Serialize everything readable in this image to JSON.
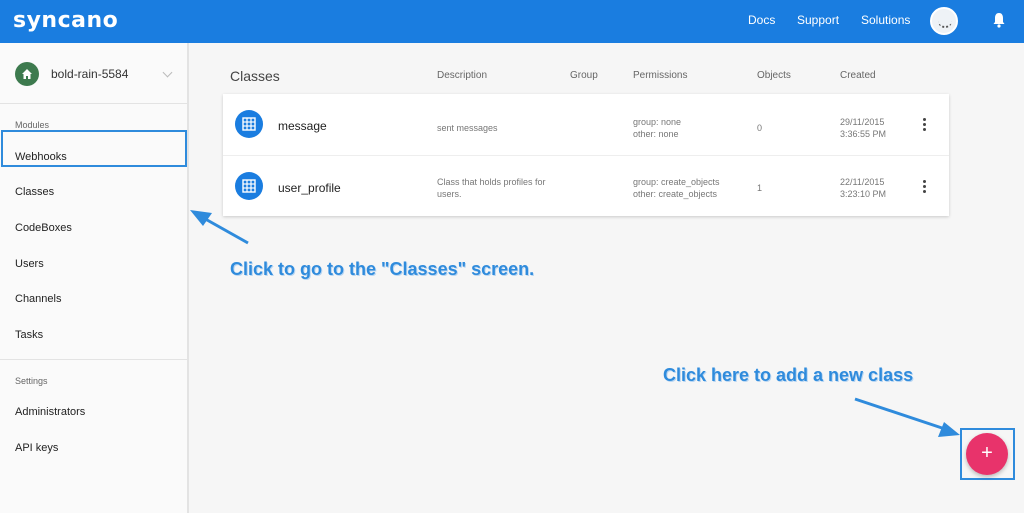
{
  "header": {
    "logo": "syncano",
    "nav": [
      "Docs",
      "Support",
      "Solutions"
    ]
  },
  "sidebar": {
    "instance_name": "bold-rain-5584",
    "modules_label": "Modules",
    "modules": [
      "Webhooks",
      "Classes",
      "CodeBoxes",
      "Users",
      "Channels",
      "Tasks"
    ],
    "settings_label": "Settings",
    "settings": [
      "Administrators",
      "API keys"
    ]
  },
  "main": {
    "title": "Classes",
    "columns": [
      "Description",
      "Group",
      "Permissions",
      "Objects",
      "Created"
    ],
    "rows": [
      {
        "name": "message",
        "description": "sent messages",
        "group": "",
        "perm_group": "group: none",
        "perm_other": "other: none",
        "objects": "0",
        "created_date": "29/11/2015",
        "created_time": "3:36:55 PM"
      },
      {
        "name": "user_profile",
        "description": "Class that holds profiles for users.",
        "group": "",
        "perm_group": "group: create_objects",
        "perm_other": "other: create_objects",
        "objects": "1",
        "created_date": "22/11/2015",
        "created_time": "3:23:10 PM"
      }
    ]
  },
  "annotations": {
    "classes_hint": "Click to go to the \"Classes\" screen.",
    "add_hint": "Click here to add a new class"
  },
  "fab": {
    "label": "+"
  },
  "colors": {
    "topbar": "#1a7de0",
    "fab": "#e8336b",
    "annotation": "#2f8bdc",
    "instance_icon": "#3d7a4e"
  },
  "icons": {
    "logo": "syncano-logo",
    "avatar": "user-avatar",
    "bell": "bell-icon",
    "instance": "home-icon",
    "class": "table-grid-icon",
    "menu": "kebab-menu-icon"
  }
}
